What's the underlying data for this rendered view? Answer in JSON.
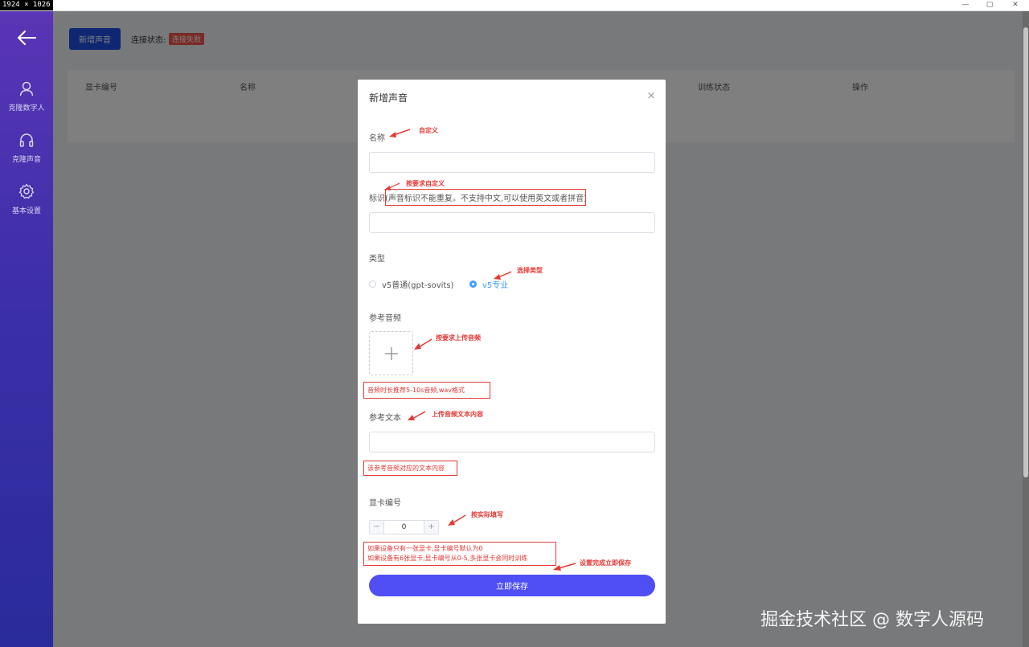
{
  "window": {
    "dimension_label": "1924 × 1026",
    "buttons": [
      "—",
      "▢",
      "✕"
    ]
  },
  "sidebar": {
    "items": [
      {
        "label": "克隆数字人",
        "icon": "user-icon"
      },
      {
        "label": "克隆声音",
        "icon": "headphones-icon"
      },
      {
        "label": "基本设置",
        "icon": "gear-icon"
      }
    ]
  },
  "toolbar": {
    "add_voice_label": "新增声音",
    "connection_label": "连接状态:",
    "connection_status": "连接失败",
    "connection_color": "#f2574e"
  },
  "table": {
    "columns": [
      "显卡编号",
      "名称",
      "训练状态",
      "操作"
    ]
  },
  "dialog": {
    "title": "新增声音",
    "fields": {
      "name": {
        "label": "名称",
        "value": ""
      },
      "identifier": {
        "label": "标识",
        "hint": "(声音标识不能重复。不支持中文,可以使用英文或者拼音)",
        "value": ""
      },
      "type": {
        "label": "类型",
        "options": [
          {
            "label": "v5普通(gpt-sovits)",
            "checked": false
          },
          {
            "label": "v5专业",
            "checked": true
          }
        ]
      },
      "ref_audio": {
        "label": "参考音频"
      },
      "ref_text": {
        "label": "参考文本",
        "value": ""
      },
      "gpu_id": {
        "label": "显卡编号",
        "value": "0"
      }
    },
    "save_label": "立即保存",
    "accent_color": "#4f4ff5"
  },
  "annotations": {
    "name_note": "自定义",
    "identifier_note": "按要求自定义",
    "type_note": "选择类型",
    "upload_note": "按要求上传音频",
    "audio_hint": "音频时长推荐5-10s音频,wav格式",
    "ref_text_note": "上传音频文本内容",
    "ref_text_hint": "该参考音频对应的文本内容",
    "gpu_note": "按实际填写",
    "gpu_hint_line1": "如果设备只有一张显卡,显卡编号默认为0",
    "gpu_hint_line2": "如果设备有6张显卡,显卡编号从0-5,多张显卡会同时训练",
    "save_note": "设置完成立即保存",
    "color": "#e53935"
  },
  "watermark": "掘金技术社区 @ 数字人源码"
}
